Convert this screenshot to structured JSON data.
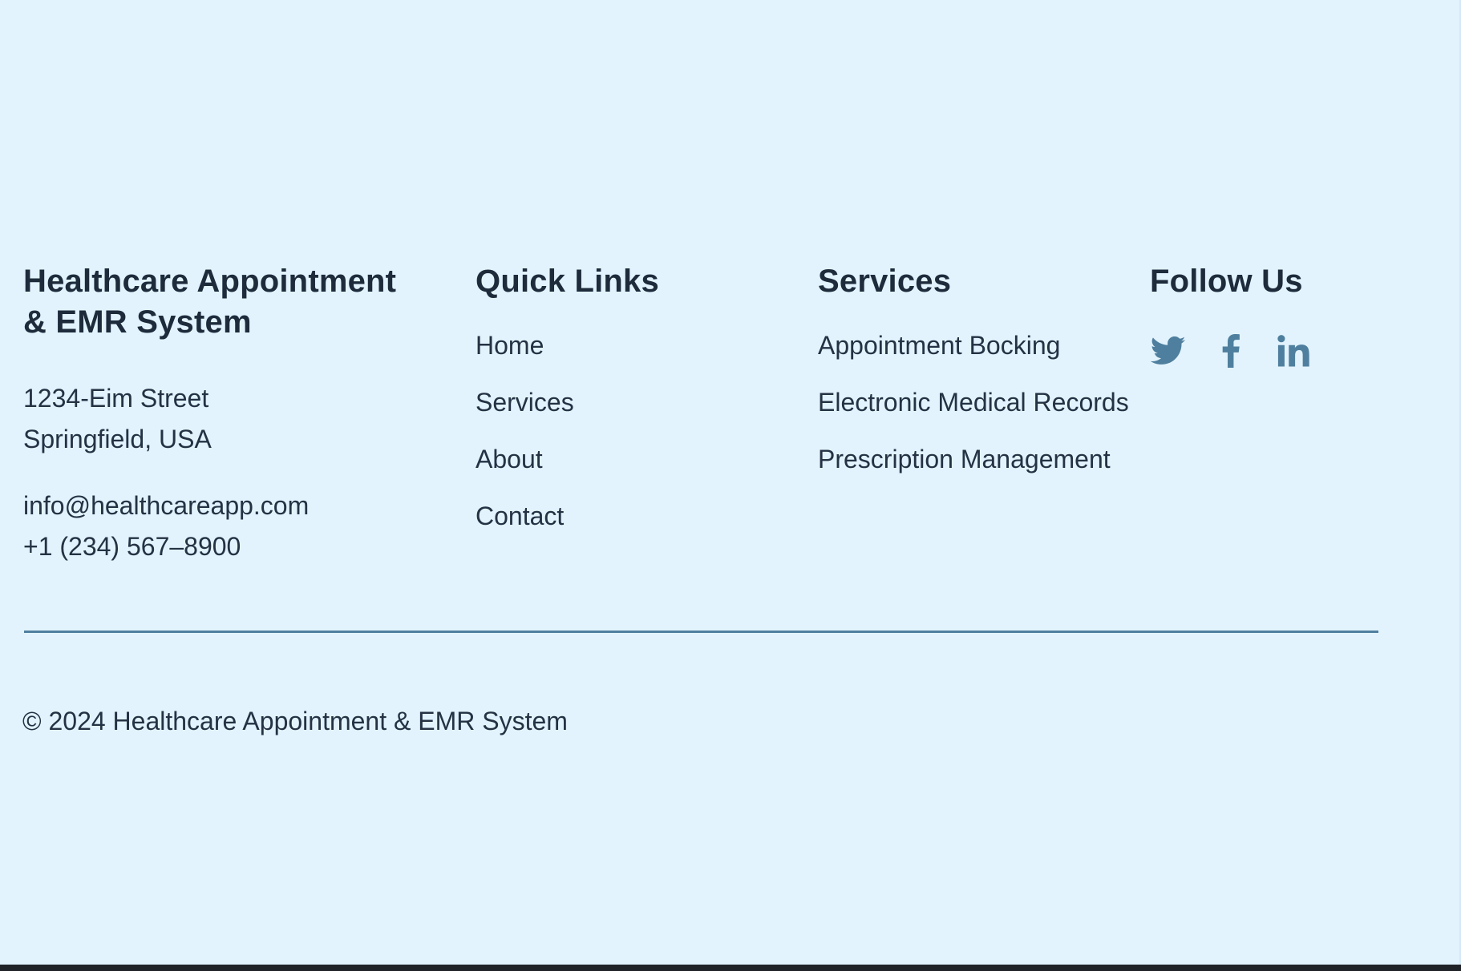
{
  "colors": {
    "background": "#e2f3fd",
    "text": "#243243",
    "heading": "#1d2b3b",
    "accent": "#4f7f9e",
    "social_icon": "#4f7f9e"
  },
  "footer": {
    "brand": {
      "title_line_1": "Healthcare Appointment",
      "title_line_2": "& EMR System",
      "address_line_1": "1234-Eim Street",
      "address_line_2": "Springfield, USA",
      "email": "info@healthcareapp.com",
      "phone": "+1 (234) 567–8900"
    },
    "quick_links": {
      "title": "Quick Links",
      "items": [
        "Home",
        "Services",
        "About",
        "Contact"
      ]
    },
    "services": {
      "title": "Services",
      "items": [
        "Appointment Bocking",
        "Electronic Medical Records",
        "Prescription Management"
      ]
    },
    "follow": {
      "title": "Follow Us",
      "icons": [
        "twitter-icon",
        "facebook-icon",
        "linkedin-icon"
      ]
    },
    "copyright": "© 2024 Healthcare Appointment & EMR System"
  }
}
